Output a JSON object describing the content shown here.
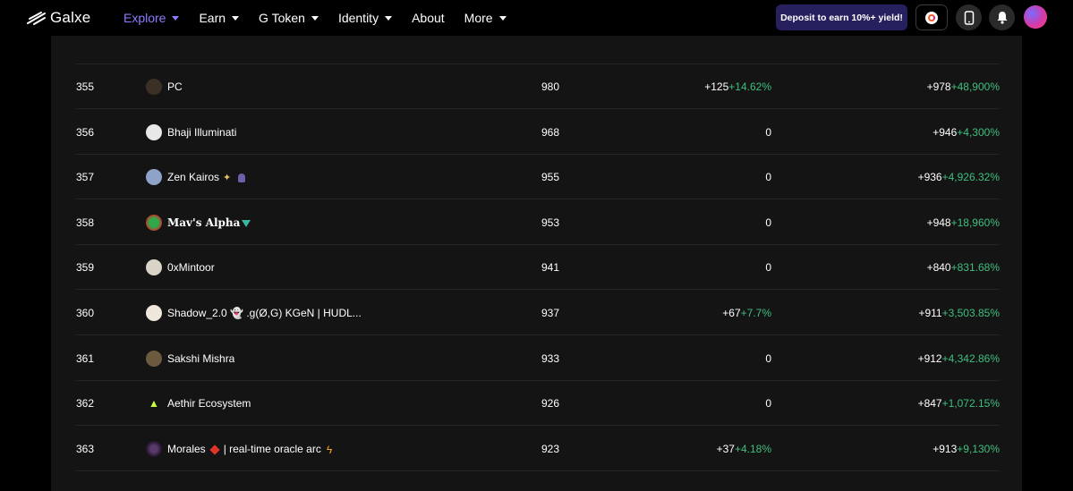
{
  "nav": {
    "logo_text": "Galxe",
    "items": [
      {
        "label": "Explore",
        "has_caret": true,
        "active": true
      },
      {
        "label": "Earn",
        "has_caret": true,
        "active": false
      },
      {
        "label": "G Token",
        "has_caret": true,
        "active": false
      },
      {
        "label": "Identity",
        "has_caret": true,
        "active": false
      },
      {
        "label": "About",
        "has_caret": false,
        "active": false
      },
      {
        "label": "More",
        "has_caret": true,
        "active": false
      }
    ],
    "deposit_label": "Deposit to earn 10%+ yield!",
    "accent_color": "#8a7cff",
    "icons": [
      "galxe-g-icon",
      "phone-icon",
      "bell-icon",
      "user-avatar"
    ]
  },
  "leaderboard": {
    "positive_color": "#3fbf7f",
    "rows": [
      {
        "rank": "355",
        "name": "PC",
        "points": "980",
        "change": "+125",
        "change_pct": "+14.62%",
        "total": "+978",
        "total_pct": "+48,900%"
      },
      {
        "rank": "356",
        "name": "Bhaji Illuminati",
        "points": "968",
        "change": "0",
        "change_pct": "",
        "total": "+946",
        "total_pct": "+4,300%"
      },
      {
        "rank": "357",
        "name": "Zen Kairos",
        "points": "955",
        "change": "0",
        "change_pct": "",
        "total": "+936",
        "total_pct": "+4,926.32%"
      },
      {
        "rank": "358",
        "name": "Mav's Alpha",
        "points": "953",
        "change": "0",
        "change_pct": "",
        "total": "+948",
        "total_pct": "+18,960%"
      },
      {
        "rank": "359",
        "name": "0xMintoor",
        "points": "941",
        "change": "0",
        "change_pct": "",
        "total": "+840",
        "total_pct": "+831.68%"
      },
      {
        "rank": "360",
        "name": "Shadow_2.0 👻 .g(Ø,G) KGeN | HUDL...",
        "points": "937",
        "change": "+67",
        "change_pct": "+7.7%",
        "total": "+911",
        "total_pct": "+3,503.85%"
      },
      {
        "rank": "361",
        "name": "Sakshi Mishra",
        "points": "933",
        "change": "0",
        "change_pct": "",
        "total": "+912",
        "total_pct": "+4,342.86%"
      },
      {
        "rank": "362",
        "name": "Aethir Ecosystem",
        "points": "926",
        "change": "0",
        "change_pct": "",
        "total": "+847",
        "total_pct": "+1,072.15%"
      },
      {
        "rank": "363",
        "name": "Morales",
        "name_suffix": "| real-time oracle arc",
        "points": "923",
        "change": "+37",
        "change_pct": "+4.18%",
        "total": "+913",
        "total_pct": "+9,130%"
      }
    ]
  }
}
